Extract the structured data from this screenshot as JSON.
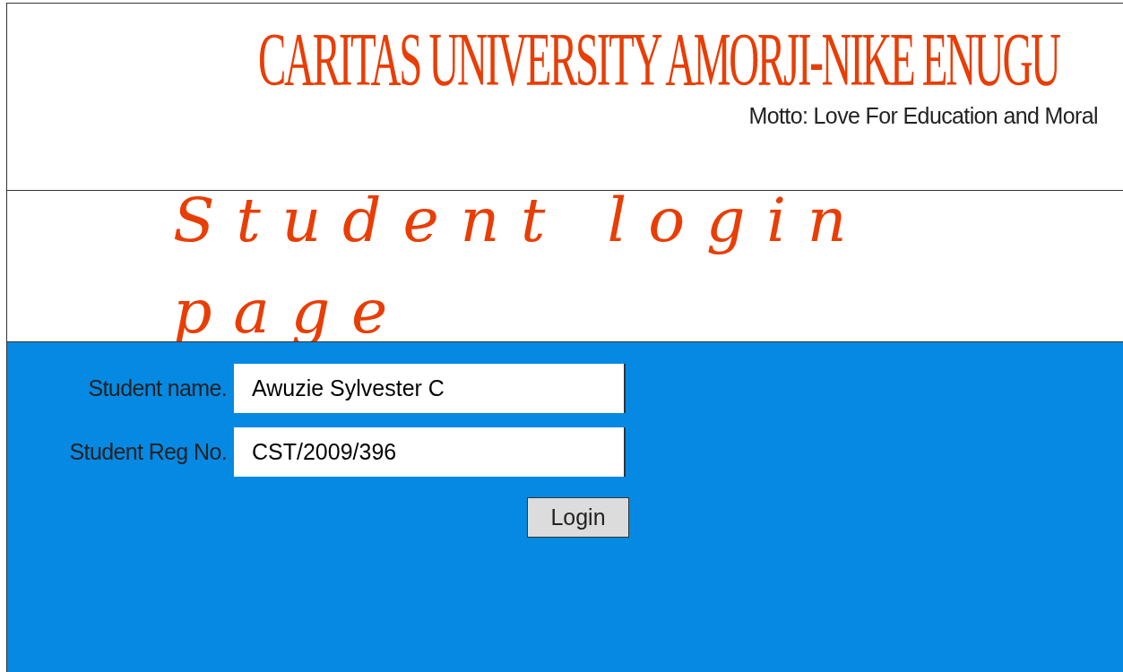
{
  "header": {
    "title": "CARITAS UNIVERSITY AMORJI-NIKE ENUGU",
    "motto": "Motto: Love For Education and Moral"
  },
  "page_title": "Student login page",
  "form": {
    "fields": [
      {
        "label": "Student name.",
        "value": "Awuzie Sylvester C"
      },
      {
        "label": "Student Reg No.",
        "value": "CST/2009/396"
      }
    ],
    "button": "Login"
  }
}
